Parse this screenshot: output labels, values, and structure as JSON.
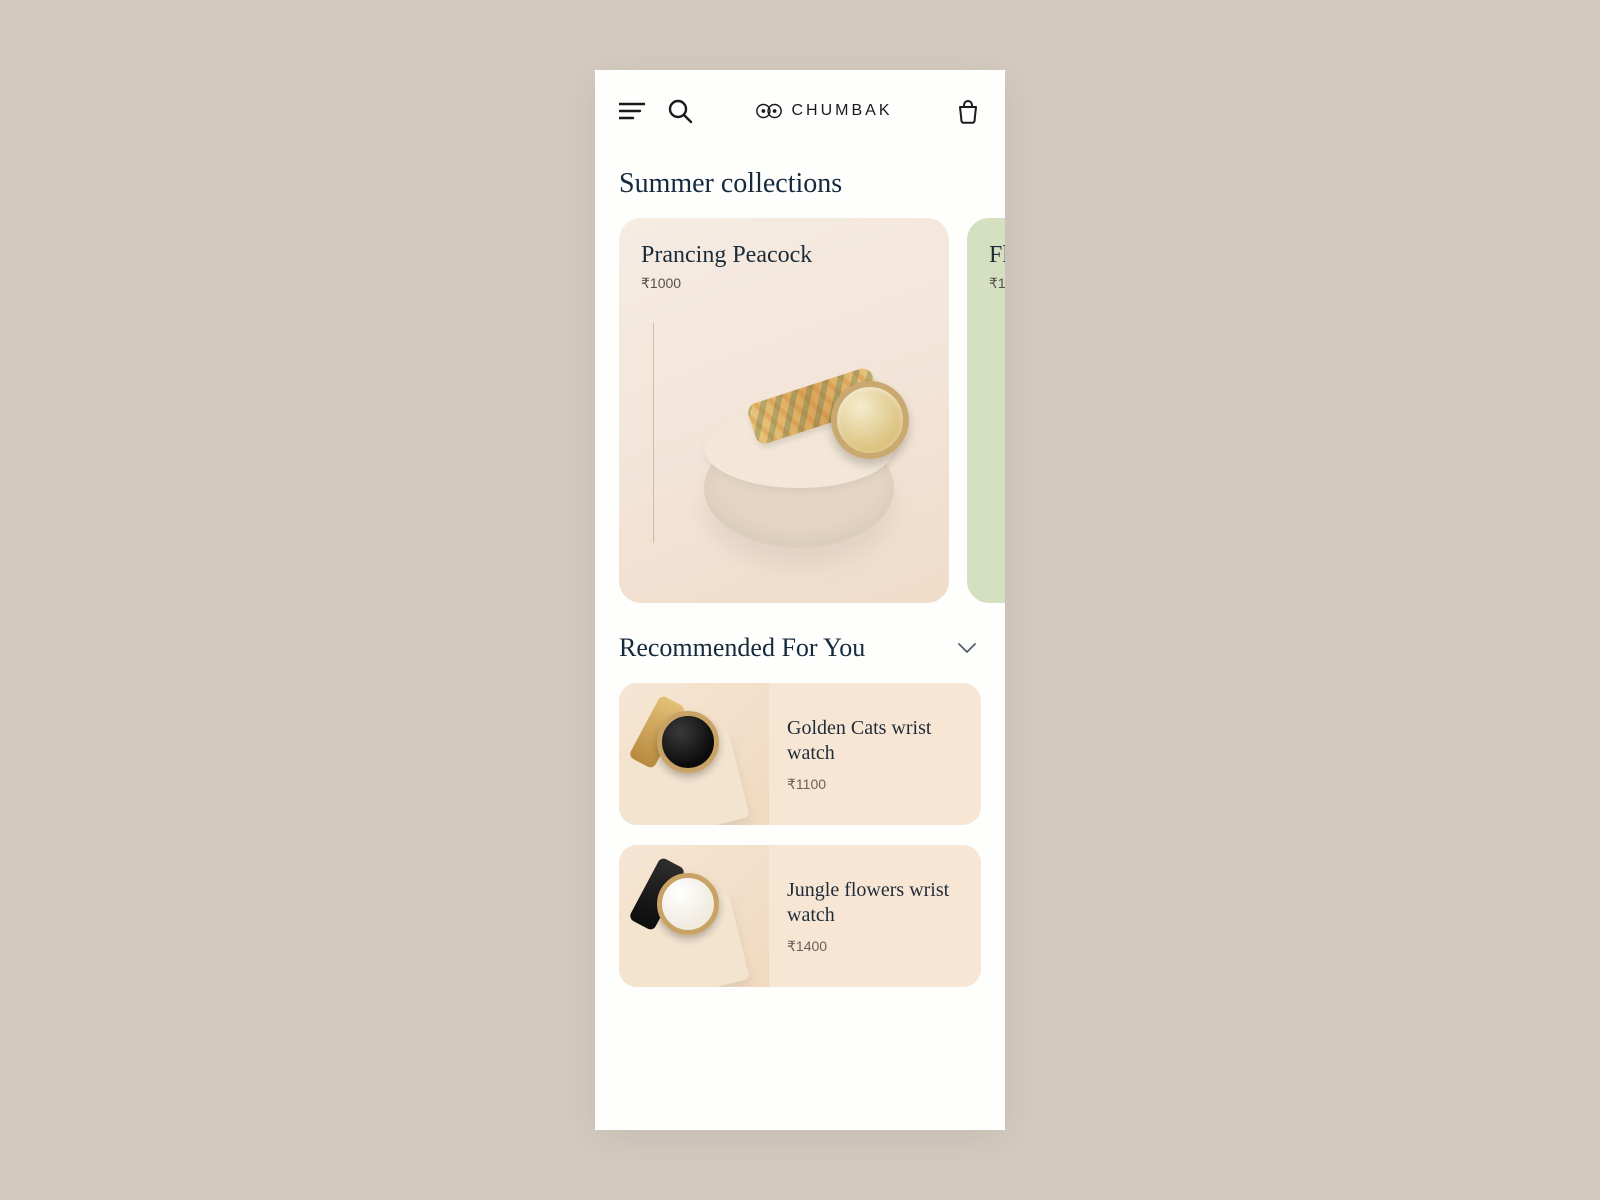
{
  "brand": {
    "name": "CHUMBAK"
  },
  "sections": {
    "collections_title": "Summer collections",
    "recommended_title": "Recommended For You"
  },
  "carousel": [
    {
      "name": "Prancing Peacock",
      "price": "₹1000"
    },
    {
      "name": "Fl",
      "price": "₹1"
    }
  ],
  "recommended": [
    {
      "name": "Golden Cats wrist watch",
      "price": "₹1100"
    },
    {
      "name": "Jungle flowers wrist watch",
      "price": "₹1400"
    }
  ],
  "colors": {
    "page_bg": "#d4cac0",
    "card_peach": "#f4e6d8",
    "card_green": "#d5e0c1",
    "list_bg": "#f8e6d4",
    "title": "#162a3e"
  }
}
